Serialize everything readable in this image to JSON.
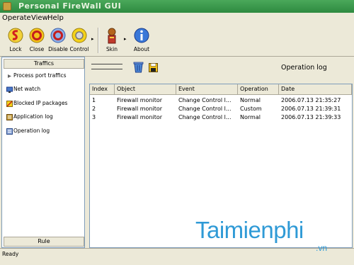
{
  "window": {
    "title": "Personal FireWall GUI"
  },
  "menu": [
    "Operate",
    "View",
    "Help"
  ],
  "toolbar": {
    "buttons": [
      {
        "label": "Lock",
        "icon": "lock-icon"
      },
      {
        "label": "Close",
        "icon": "close-icon"
      },
      {
        "label": "Disable",
        "icon": "disable-icon"
      },
      {
        "label": "Control",
        "icon": "control-icon"
      },
      {
        "label": "Skin",
        "icon": "skin-icon"
      },
      {
        "label": "About",
        "icon": "about-icon"
      }
    ]
  },
  "sidebar": {
    "header": "Traffics",
    "items": [
      {
        "label": "Process port traffics",
        "icon": "process-icon"
      },
      {
        "label": "Net watch",
        "icon": "net-watch-icon"
      },
      {
        "label": "Blocked IP packages",
        "icon": "blocked-ip-icon"
      },
      {
        "label": "Application log",
        "icon": "application-log-icon"
      },
      {
        "label": "Operation log",
        "icon": "operation-log-icon"
      }
    ],
    "footer": "Rule"
  },
  "main": {
    "title": "Operation log",
    "table": {
      "columns": [
        "Index",
        "Object",
        "Event",
        "Operation",
        "Date"
      ],
      "rows": [
        [
          "1",
          "Firewall monitor",
          "Change Control l...",
          "Normal",
          "2006.07.13 21:35:27"
        ],
        [
          "2",
          "Firewall monitor",
          "Change Control l...",
          "Custom",
          "2006.07.13 21:39:31"
        ],
        [
          "3",
          "Firewall monitor",
          "Change Control l...",
          "Normal",
          "2006.07.13 21:39:33"
        ]
      ]
    }
  },
  "status": "Ready",
  "watermark": {
    "main": "Taimienphi",
    "sub": ".vn"
  },
  "colors": {
    "titlebar": "#3a9a4c",
    "accent": "#2f9ad6",
    "face": "#ece9d8"
  }
}
